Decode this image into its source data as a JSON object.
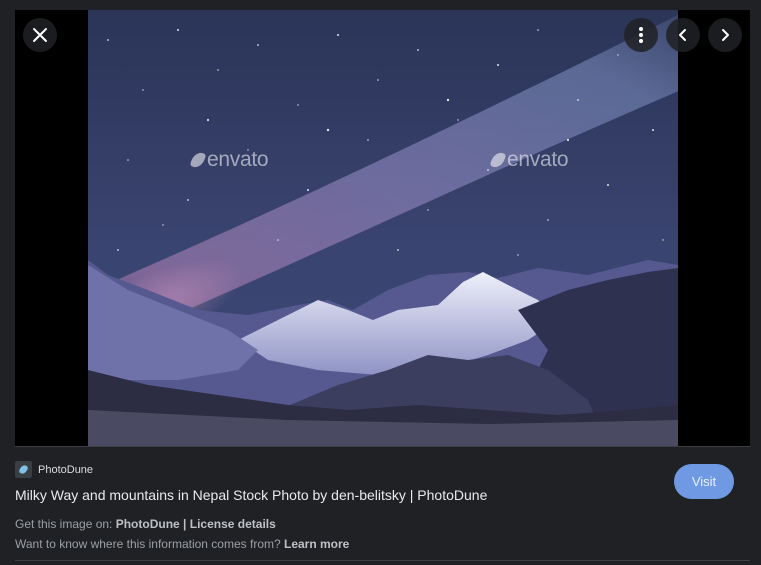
{
  "viewer": {
    "watermark_text": "envato",
    "close_icon": "close-icon",
    "more_icon": "more-vertical-icon",
    "prev_icon": "chevron-left-icon",
    "next_icon": "chevron-right-icon"
  },
  "source": {
    "name": "PhotoDune",
    "favicon_icon": "photodune-favicon-icon"
  },
  "title": "Milky Way and mountains in Nepal Stock Photo by den-belitsky | PhotoDune",
  "get_image": {
    "prefix": "Get this image on: ",
    "site": "PhotoDune",
    "separator": " | ",
    "license": "License details"
  },
  "info": {
    "question": "Want to know where this information comes from? ",
    "learn_more": "Learn more"
  },
  "visit_button": "Visit",
  "colors": {
    "background": "#202124",
    "visit_button": "#6f9ae3",
    "text_primary": "#e8eaed",
    "text_secondary": "#9aa0a6"
  }
}
